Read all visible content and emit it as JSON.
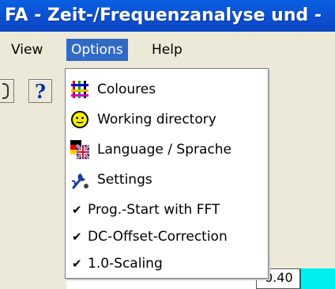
{
  "window": {
    "title": "FA - Zeit-/Frequenzanalyse und -"
  },
  "menubar": {
    "view": "View",
    "options": "Options",
    "help": "Help"
  },
  "toolbar": {
    "help_button_glyph": "?"
  },
  "options_menu": {
    "items": [
      {
        "label": "Coloures",
        "icon": "colours-grid-icon"
      },
      {
        "label": "Working directory",
        "icon": "smiley-face-icon"
      },
      {
        "label": "Language / Sprache",
        "icon": "flags-icon"
      },
      {
        "label": "Settings",
        "icon": "wrench-settings-icon"
      },
      {
        "label": "Prog.-Start with FFT",
        "checked": true
      },
      {
        "label": "DC-Offset-Correction",
        "checked": true
      },
      {
        "label": "1.0-Scaling",
        "checked": true
      }
    ],
    "check_glyph": "✔"
  },
  "status": {
    "value": "0.40"
  },
  "colors": {
    "titlebar": "#0b4fd0",
    "menu_highlight": "#316ac5",
    "cyan_box": "#00f0f0"
  }
}
